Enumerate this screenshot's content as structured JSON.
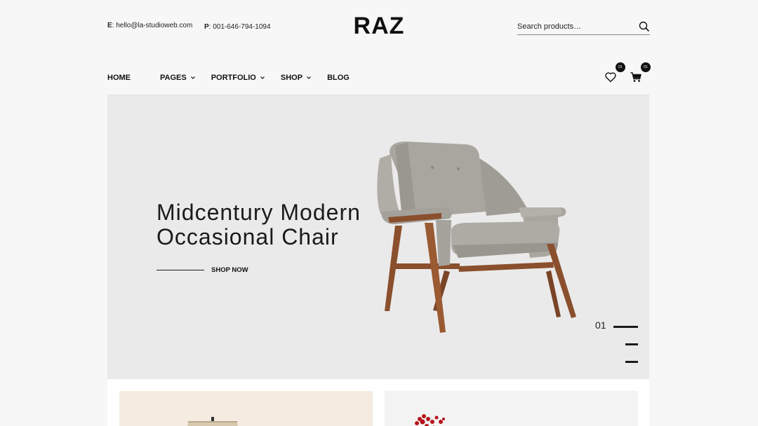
{
  "header": {
    "email_label": "E",
    "email_value": ": hello@la-studioweb.com",
    "phone_label": "P",
    "phone_value": ": 001-646-794-1094",
    "logo": "RAZ",
    "search_placeholder": "Search products…"
  },
  "nav": {
    "items": [
      {
        "label": "HOME"
      },
      {
        "label": "PAGES"
      },
      {
        "label": "PORTFOLIO"
      },
      {
        "label": "SHOP"
      },
      {
        "label": "BLOG"
      }
    ]
  },
  "counters": {
    "wishlist_count": "01",
    "cart_count": "01"
  },
  "hero": {
    "title_line1": "Midcentury Modern",
    "title_line2": "Occasional Chair",
    "cta": "SHOP NOW",
    "slide_number": "01"
  },
  "colors": {
    "hero_bg": "#ebeaea",
    "text": "#1a1a1a",
    "chair_fabric": "#a9a6a0",
    "chair_wood": "#8a4f2c",
    "card_1_bg": "#f5ebe0",
    "card_2_bg": "#f3f3f3"
  },
  "icons": [
    "search-icon",
    "chevron-down-icon",
    "heart-icon",
    "cart-icon"
  ]
}
